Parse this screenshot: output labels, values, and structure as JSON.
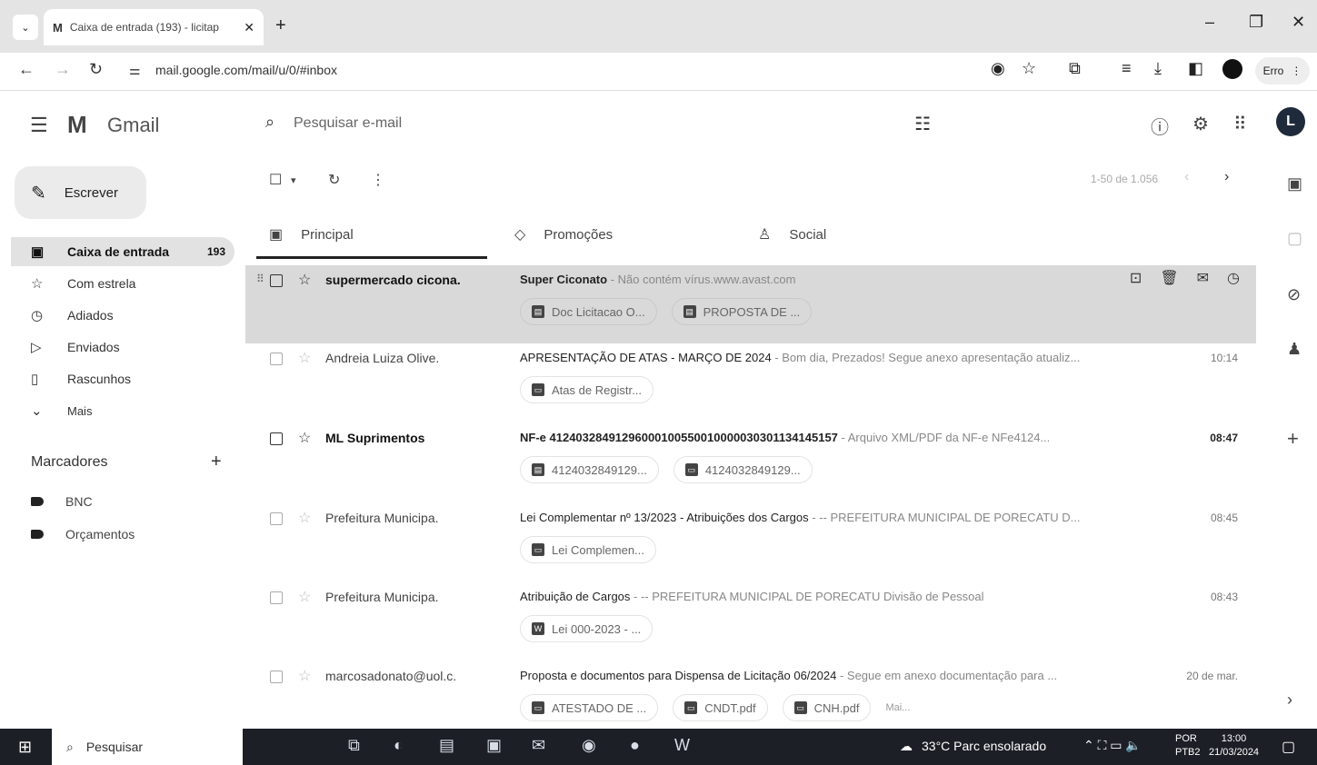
{
  "browser": {
    "tab_title": "Caixa de entrada (193) - licitap",
    "tab_favicon": "M",
    "url": "mail.google.com/mail/u/0/#inbox",
    "error_pill": "Erro"
  },
  "gmail": {
    "logo_text": "Gmail",
    "search_placeholder": "Pesquisar e-mail",
    "avatar_initial": "L",
    "compose_label": "Escrever"
  },
  "sidebar": {
    "items": [
      {
        "label": "Caixa de entrada",
        "count": "193",
        "icon": "inbox-icon"
      },
      {
        "label": "Com estrela",
        "icon": "star-icon"
      },
      {
        "label": "Adiados",
        "icon": "clock-icon"
      },
      {
        "label": "Enviados",
        "icon": "send-icon"
      },
      {
        "label": "Rascunhos",
        "icon": "draft-icon"
      },
      {
        "label": "Mais",
        "icon": "chevron-down-icon"
      }
    ],
    "labels_title": "Marcadores",
    "labels": [
      {
        "label": "BNC"
      },
      {
        "label": "Orçamentos"
      }
    ]
  },
  "toolbar": {
    "pager": "1-50 de 1.056"
  },
  "tabs": [
    {
      "label": "Principal",
      "icon": "inbox-icon"
    },
    {
      "label": "Promoções",
      "icon": "tag-icon"
    },
    {
      "label": "Social",
      "icon": "people-icon"
    }
  ],
  "emails": [
    {
      "sender": "supermercado cicona.",
      "subject": "Super Ciconato",
      "snippet": " - Não contém vírus.www.avast.com",
      "time": "",
      "attachments": [
        "Doc Licitacao O...",
        "PROPOSTA DE ..."
      ]
    },
    {
      "sender": "Andreia Luiza Olive.",
      "subject": "APRESENTAÇÃO DE ATAS - MARÇO DE 2024",
      "snippet": " - Bom dia, Prezados! Segue anexo apresentação atualiz...",
      "time": "10:14",
      "attachments": [
        "Atas de Registr..."
      ]
    },
    {
      "sender": "ML Suprimentos",
      "subject": "NF-e 41240328491296000100550010000030301134145157",
      "snippet": " - Arquivo XML/PDF da NF-e NFe4124...",
      "time": "08:47",
      "attachments": [
        "4124032849129...",
        "4124032849129..."
      ]
    },
    {
      "sender": "Prefeitura Municipa.",
      "subject": "Lei Complementar nº 13/2023 - Atribuições dos Cargos",
      "snippet": " - -- PREFEITURA MUNICIPAL DE PORECATU D...",
      "time": "08:45",
      "attachments": [
        "Lei Complemen..."
      ]
    },
    {
      "sender": "Prefeitura Municipa.",
      "subject": "Atribuição de Cargos",
      "snippet": " - -- PREFEITURA MUNICIPAL DE PORECATU Divisão de Pessoal",
      "time": "08:43",
      "attachments": [
        "Lei 000-2023 - ..."
      ]
    },
    {
      "sender": "marcosadonato@uol.c.",
      "subject": "Proposta e documentos para Dispensa de Licitação 06/2024",
      "snippet": " - Segue em anexo documentação para ...",
      "time": "20 de mar.",
      "attachments": [
        "ATESTADO DE ...",
        "CNDT.pdf",
        "CNH.pdf"
      ],
      "more": "Mai..."
    }
  ],
  "taskbar": {
    "search_label": "Pesquisar",
    "weather": "33°C  Parc ensolarado",
    "lang_top": "POR",
    "lang_bottom": "PTB2",
    "time": "13:00",
    "date": "21/03/2024"
  }
}
